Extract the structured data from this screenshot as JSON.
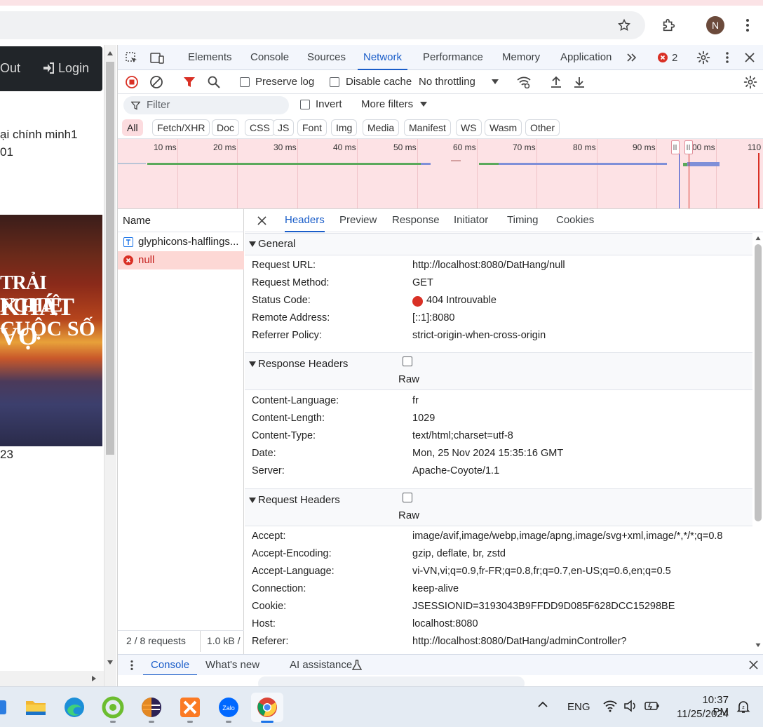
{
  "browser": {
    "avatar_letter": "N"
  },
  "page": {
    "nav_logout_partial": "Out",
    "nav_login": "Login",
    "text_line1": "ại chính minh1",
    "text_line2": "01",
    "price_partial": "23",
    "book_cover_text": [
      "TRẢI NGHIỆ",
      "KHÁT VỌ",
      "CUỘC SỐ"
    ]
  },
  "devtools": {
    "tabs": [
      "Elements",
      "Console",
      "Sources",
      "Network",
      "Performance",
      "Memory",
      "Application"
    ],
    "active_tab": "Network",
    "error_count": "2",
    "toolbar": {
      "preserve_log": "Preserve log",
      "disable_cache": "Disable cache",
      "throttling": "No throttling"
    },
    "filter": {
      "placeholder": "Filter",
      "invert": "Invert",
      "more_filters": "More filters"
    },
    "type_filters": [
      "All",
      "Fetch/XHR",
      "Doc",
      "CSS",
      "JS",
      "Font",
      "Img",
      "Media",
      "Manifest",
      "WS",
      "Wasm",
      "Other"
    ],
    "active_type": "All",
    "timeline_ticks": [
      "10 ms",
      "20 ms",
      "30 ms",
      "40 ms",
      "50 ms",
      "60 ms",
      "70 ms",
      "80 ms",
      "90 ms",
      "00 ms",
      "110"
    ],
    "requests": {
      "header": "Name",
      "rows": [
        {
          "name": "glyphicons-halflings...",
          "type": "font",
          "error": false
        },
        {
          "name": "null",
          "type": "error",
          "error": true
        }
      ],
      "footer_count": "2 / 8 requests",
      "footer_size": "1.0 kB /"
    },
    "detail_tabs": [
      "Headers",
      "Preview",
      "Response",
      "Initiator",
      "Timing",
      "Cookies"
    ],
    "active_detail_tab": "Headers",
    "general": {
      "title": "General",
      "rows": [
        {
          "key": "Request URL:",
          "value": "http://localhost:8080/DatHang/null"
        },
        {
          "key": "Request Method:",
          "value": "GET"
        },
        {
          "key": "Status Code:",
          "value": "404 Introuvable"
        },
        {
          "key": "Remote Address:",
          "value": "[::1]:8080"
        },
        {
          "key": "Referrer Policy:",
          "value": "strict-origin-when-cross-origin"
        }
      ]
    },
    "response_headers": {
      "title": "Response Headers",
      "raw": "Raw",
      "rows": [
        {
          "key": "Content-Language:",
          "value": "fr"
        },
        {
          "key": "Content-Length:",
          "value": "1029"
        },
        {
          "key": "Content-Type:",
          "value": "text/html;charset=utf-8"
        },
        {
          "key": "Date:",
          "value": "Mon, 25 Nov 2024 15:35:16 GMT"
        },
        {
          "key": "Server:",
          "value": "Apache-Coyote/1.1"
        }
      ]
    },
    "request_headers": {
      "title": "Request Headers",
      "raw": "Raw",
      "rows": [
        {
          "key": "Accept:",
          "value": "image/avif,image/webp,image/apng,image/svg+xml,image/*,*/*;q=0.8"
        },
        {
          "key": "Accept-Encoding:",
          "value": "gzip, deflate, br, zstd"
        },
        {
          "key": "Accept-Language:",
          "value": "vi-VN,vi;q=0.9,fr-FR;q=0.8,fr;q=0.7,en-US;q=0.6,en;q=0.5"
        },
        {
          "key": "Connection:",
          "value": "keep-alive"
        },
        {
          "key": "Cookie:",
          "value": "JSESSIONID=3193043B9FFDD9D085F628DCC15298BE"
        },
        {
          "key": "Host:",
          "value": "localhost:8080"
        },
        {
          "key": "Referer:",
          "value": "http://localhost:8080/DatHang/adminController?"
        }
      ]
    },
    "drawer": {
      "tabs": [
        "Console",
        "What's new",
        "AI assistance"
      ],
      "active": "Console"
    }
  },
  "taskbar": {
    "language": "ENG",
    "time": "10:37 PM",
    "date": "11/25/2024"
  },
  "colors": {
    "accent": "#1a5dc9",
    "error": "#d93025",
    "timeline_bg": "#fde2e5",
    "selected_row": "#fdd8d5"
  }
}
